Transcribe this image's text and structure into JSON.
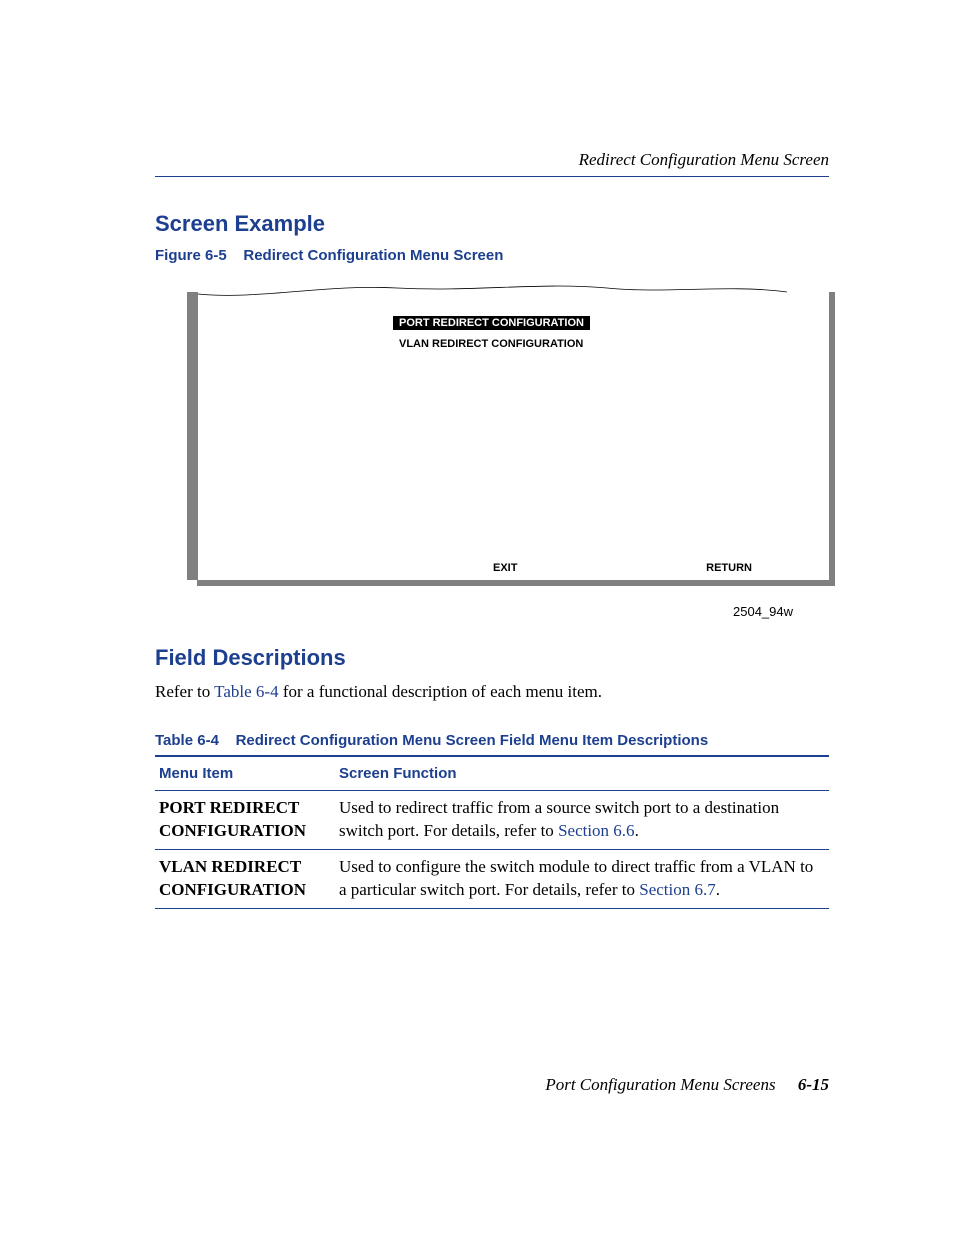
{
  "header": {
    "section": "Redirect Configuration Menu Screen"
  },
  "sec1": {
    "title": "Screen Example",
    "figcap_label": "Figure 6-5",
    "figcap_text": "Redirect Configuration Menu Screen"
  },
  "terminal": {
    "item_highlight": "PORT REDIRECT CONFIGURATION",
    "item_plain": "VLAN REDIRECT CONFIGURATION",
    "exit": "EXIT",
    "return": "RETURN",
    "figid": "2504_94w"
  },
  "sec2": {
    "title": "Field Descriptions",
    "intro_a": "Refer to ",
    "intro_link": "Table 6-4",
    "intro_b": " for a functional description of each menu item."
  },
  "table": {
    "cap_label": "Table 6-4",
    "cap_text": "Redirect Configuration Menu Screen Field Menu Item Descriptions",
    "col1": "Menu Item",
    "col2": "Screen Function",
    "rows": [
      {
        "item": "PORT REDIRECT CONFIGURATION",
        "func_a": "Used to redirect traffic from a source switch port to a destination switch port. For details, refer to ",
        "func_link": "Section 6.6",
        "func_b": "."
      },
      {
        "item": "VLAN REDIRECT CONFIGURATION",
        "func_a": "Used to configure the switch module to direct traffic from a VLAN to a particular switch port. For details, refer to ",
        "func_link": "Section 6.7",
        "func_b": "."
      }
    ]
  },
  "footer": {
    "text": "Port Configuration Menu Screens",
    "page": "6-15"
  }
}
